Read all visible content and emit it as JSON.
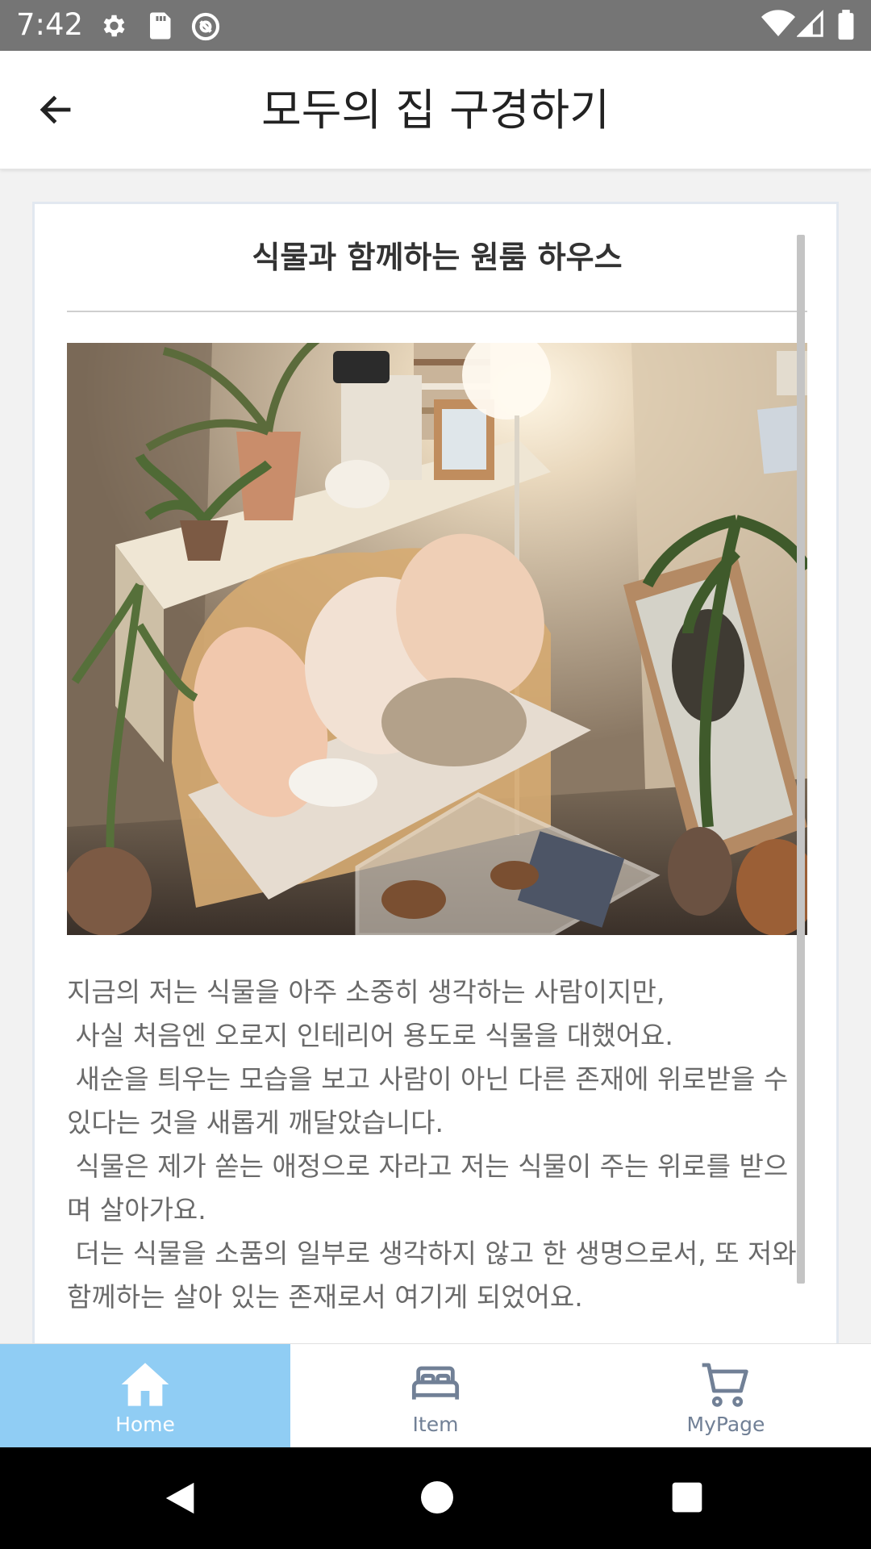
{
  "status_bar": {
    "time": "7:42",
    "left_icons": [
      "gear-icon",
      "sd-card-icon",
      "at-sign-icon"
    ],
    "right_icons": [
      "wifi-icon",
      "cellular-signal-icon",
      "battery-icon"
    ]
  },
  "app_bar": {
    "title": "모두의 집 구경하기",
    "back_icon": "arrow-left-icon"
  },
  "card": {
    "title": "식물과 함께하는 원룸 하우스",
    "photo_subject": "rattan sofa with cushions surrounded by houseplants",
    "body": "지금의 저는 식물을 아주 소중히 생각하는 사람이지만,\n 사실 처음엔 오로지 인테리어 용도로 식물을 대했어요.\n 새순을 틔우는 모습을 보고 사람이 아닌 다른 존재에 위로받을 수 있다는 것을 새롭게 깨달았습니다.\n 식물은 제가 쏟는 애정으로 자라고 저는 식물이 주는 위로를 받으며 살아가요.\n 더는 식물을 소품의 일부로 생각하지 않고 한 생명으로서, 또 저와 함께하는 살아 있는 존재로서 여기게 되었어요."
  },
  "bottom_nav": {
    "items": [
      {
        "label": "Home",
        "icon": "home-icon",
        "active": true
      },
      {
        "label": "Item",
        "icon": "bed-icon",
        "active": false
      },
      {
        "label": "MyPage",
        "icon": "cart-icon",
        "active": false
      }
    ]
  },
  "colors": {
    "status_bar": "#757575",
    "active_tab": "#90cdf4",
    "inactive_tab_text": "#718096",
    "body_text": "#6a6a6a"
  }
}
